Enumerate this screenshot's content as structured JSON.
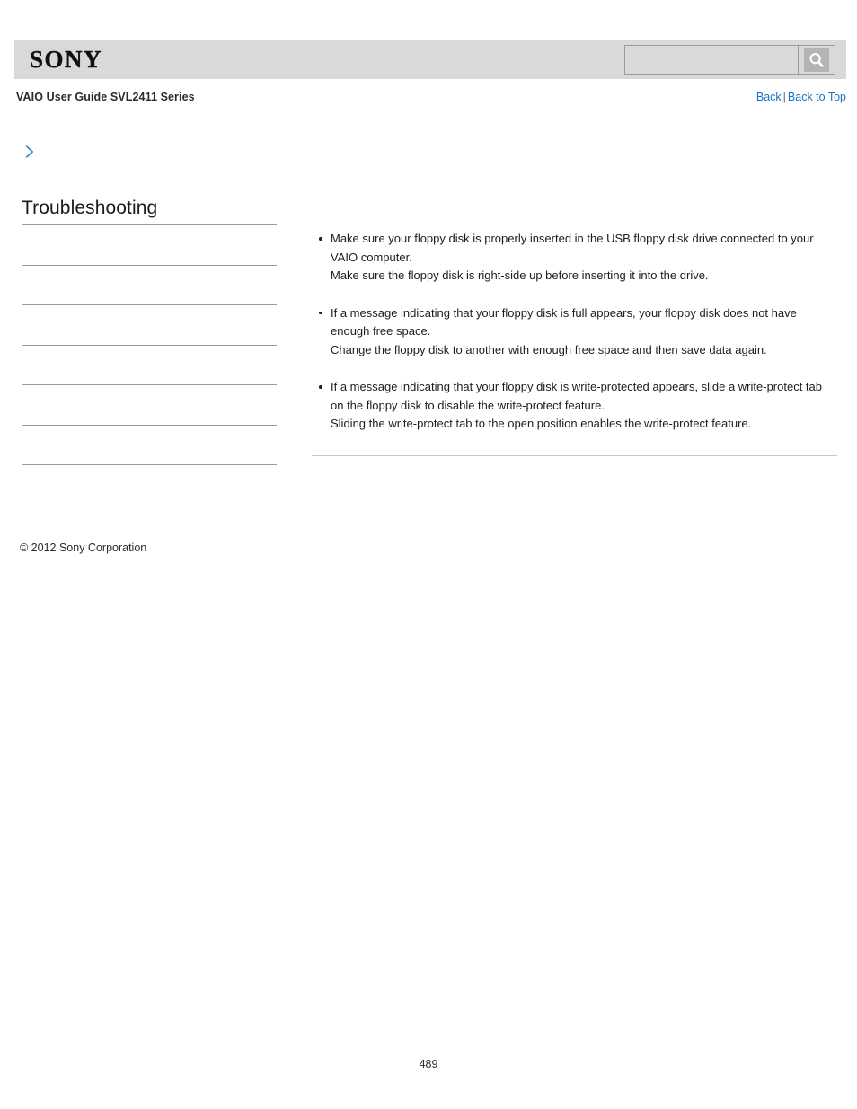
{
  "header": {
    "logo_text": "SONY",
    "logo_icon": "sony-wordmark",
    "background_color": "#d9d9d9",
    "search": {
      "value": "",
      "placeholder": "",
      "button_icon": "search-icon",
      "button_label": ""
    }
  },
  "title_bar": {
    "guide_title": "VAIO User Guide SVL2411 Series",
    "back_label": "Back",
    "separator": "|",
    "back_to_top_label": "Back to Top",
    "link_color": "#1a72c4"
  },
  "sidebar": {
    "chevron_icon": "chevron-right-icon",
    "chevron_color": "#2a86c8",
    "heading": "Troubleshooting",
    "items": [
      {
        "label": ""
      },
      {
        "label": ""
      },
      {
        "label": ""
      },
      {
        "label": ""
      },
      {
        "label": ""
      },
      {
        "label": ""
      },
      {
        "label": ""
      }
    ]
  },
  "content": {
    "bullets": [
      {
        "lines": [
          "Make sure your floppy disk is properly inserted in the USB floppy disk drive connected to your VAIO computer.",
          "Make sure the floppy disk is right-side up before inserting it into the drive."
        ]
      },
      {
        "lines": [
          "If a message indicating that your floppy disk is full appears, your floppy disk does not have enough free space.",
          "Change the floppy disk to another with enough free space and then save data again."
        ]
      },
      {
        "lines": [
          "If a message indicating that your floppy disk is write-protected appears, slide a write-protect tab on the floppy disk to disable the write-protect feature.",
          "Sliding the write-protect tab to the open position enables the write-protect feature."
        ]
      }
    ]
  },
  "footer": {
    "copyright": "© 2012 Sony Corporation",
    "page_number": "489"
  }
}
